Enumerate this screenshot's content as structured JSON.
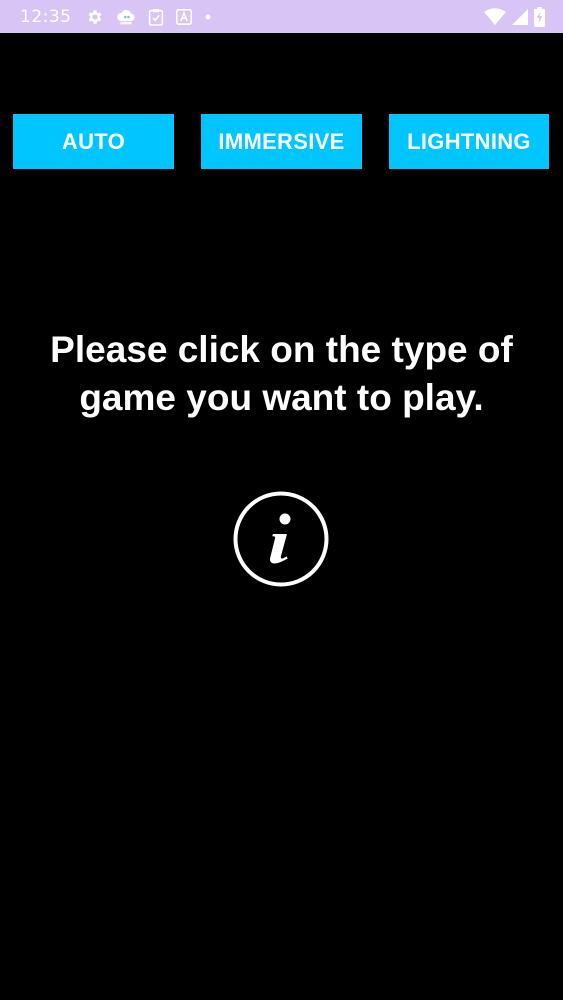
{
  "status_bar": {
    "time": "12:35",
    "left_icons": [
      "gear-icon",
      "cloud-app-icon",
      "clipboard-check-icon",
      "font-a-icon",
      "dot-icon"
    ],
    "right_icons": [
      "wifi-icon",
      "signal-icon",
      "battery-charging-icon"
    ],
    "background_color": "#d8c5f6"
  },
  "mode_buttons": {
    "auto_label": "AUTO",
    "immersive_label": "IMMERSIVE",
    "lightning_label": "LIGHTNING",
    "color": "#00c5ff"
  },
  "instruction": {
    "text": "Please click on the type of game you want to play."
  },
  "info_button": {
    "icon": "info-icon"
  }
}
